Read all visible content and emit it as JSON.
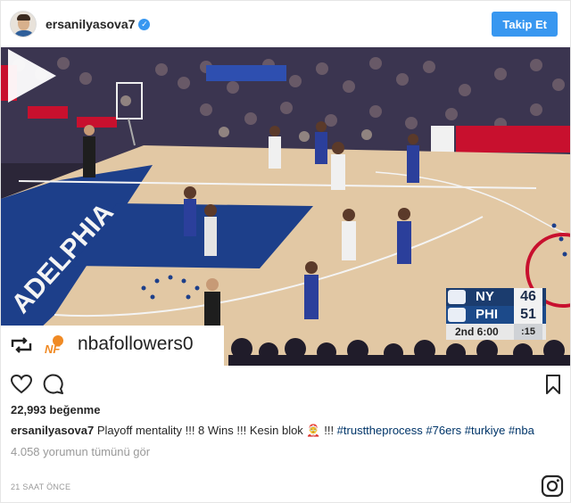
{
  "header": {
    "username": "ersanilyasova7",
    "verified_icon": "verified-badge-icon",
    "follow_label": "Takip Et",
    "follow_color": "#3897f0"
  },
  "media": {
    "type": "video",
    "play_icon": "play-icon",
    "scoreboard": {
      "away_team": "NY",
      "away_score": "46",
      "home_team": "PHI",
      "home_score": "51",
      "quarter_clock": "2nd 6:00",
      "shot_clock": ":15"
    },
    "repost": {
      "repost_icon": "repost-icon",
      "account_logo": "nbafollowers-logo-icon",
      "account": "nbafollowers0"
    },
    "court_text": "ADELPHIA"
  },
  "actions": {
    "like_icon": "heart-icon",
    "comment_icon": "comment-icon",
    "save_icon": "bookmark-icon"
  },
  "likes": "22,993 beğenme",
  "caption": {
    "user": "ersanilyasova7",
    "text": " Playoff mentality !!! 8 Wins !!! Kesin blok 🤶 !!! ",
    "hashtags": [
      "#trusttheprocess",
      "#76ers",
      "#turkiye",
      "#nba"
    ]
  },
  "comments_link": "4.058 yorumun tümünü gör",
  "timestamp": "21 SAAT ÖNCE",
  "footer": {
    "brand_icon": "instagram-icon"
  }
}
